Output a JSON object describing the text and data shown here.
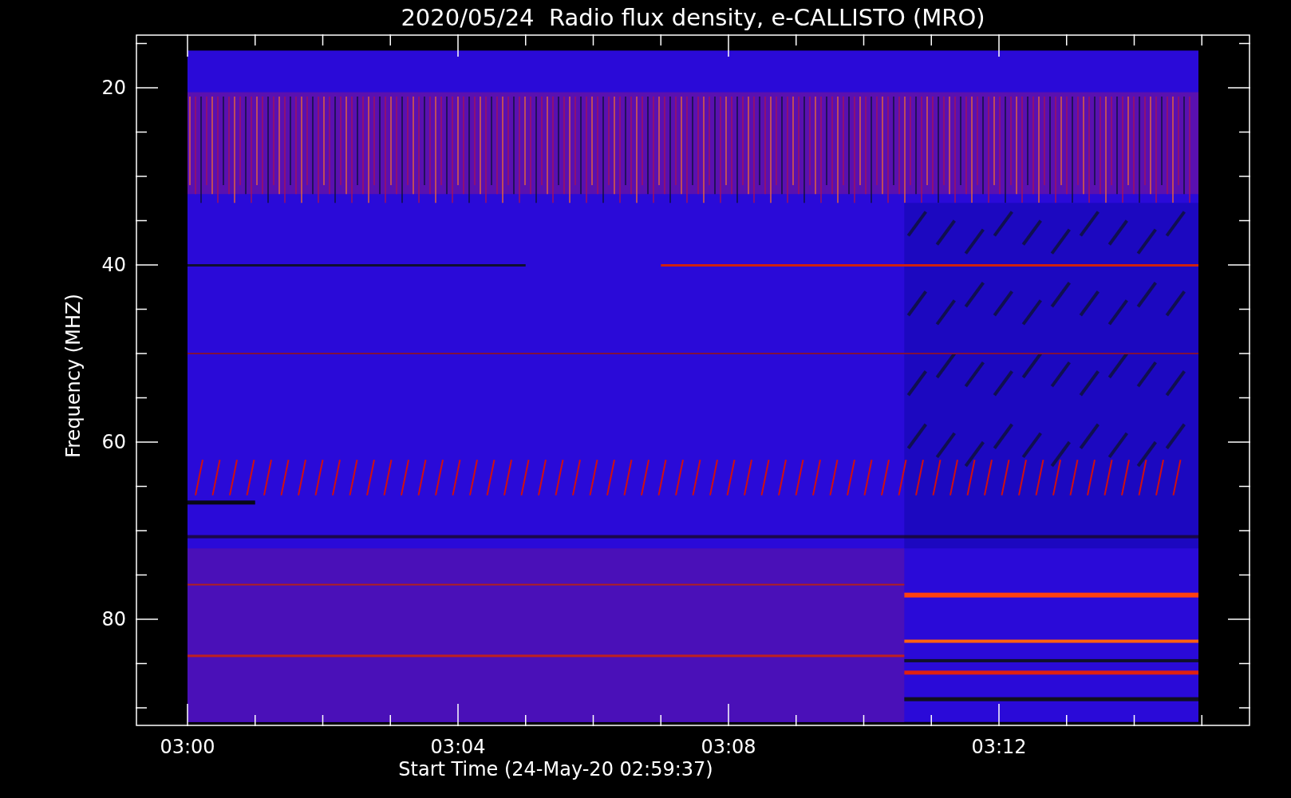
{
  "title": "2020/05/24  Radio flux density, e-CALLISTO (MRO)",
  "y_axis": {
    "label": "Frequency (MHZ)",
    "ticks": [
      "20",
      "40",
      "60",
      "80"
    ]
  },
  "x_axis": {
    "label": "Start Time (24-May-20 02:59:37)",
    "ticks": [
      "03:00",
      "03:04",
      "03:08",
      "03:12"
    ]
  }
}
